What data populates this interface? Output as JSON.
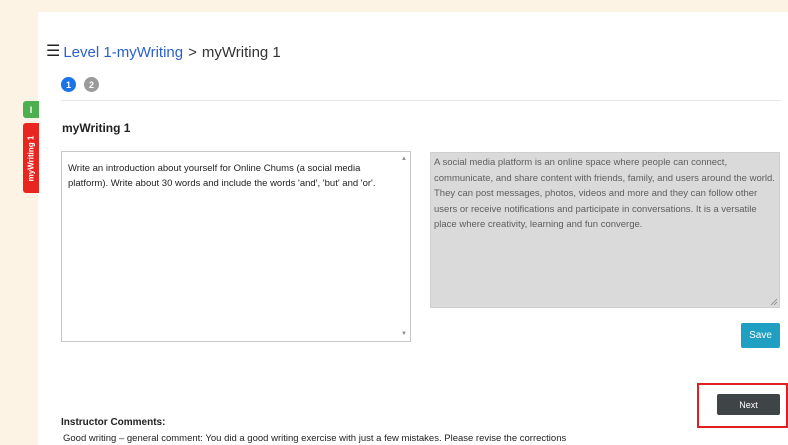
{
  "breadcrumb": {
    "menu_icon": "hamburger-icon",
    "link_label": "Level 1-myWriting",
    "separator": ">",
    "current": "myWriting 1"
  },
  "steps": [
    "1",
    "2"
  ],
  "side_tabs": {
    "green": "I",
    "red": "myWriting 1"
  },
  "section_title": "myWriting 1",
  "prompt": "Write an introduction about yourself for Online Chums (a social media platform). Write about 30 words and include the words 'and', 'but' and 'or'.",
  "response": "A social media platform is an online space where people can connect, communicate, and share content with friends, family, and users around the world. They can post messages, photos, videos and more and they can follow other users or receive notifications and participate in conversations. It is a versatile place where creativity, learning and fun converge.",
  "buttons": {
    "save": "Save",
    "next": "Next"
  },
  "instructor": {
    "label": "Instructor Comments:",
    "comment": "Good writing – general comment: You did a good writing exercise with just a few mistakes. Please revise the corrections"
  },
  "colors": {
    "page_bg": "#fdf3e4",
    "link": "#2b5fce",
    "step_active": "#1a73e8",
    "save": "#1f9fc1",
    "next": "#3f4446",
    "highlight": "#e02020",
    "tab_green": "#4caf50",
    "tab_red": "#e8261f"
  }
}
